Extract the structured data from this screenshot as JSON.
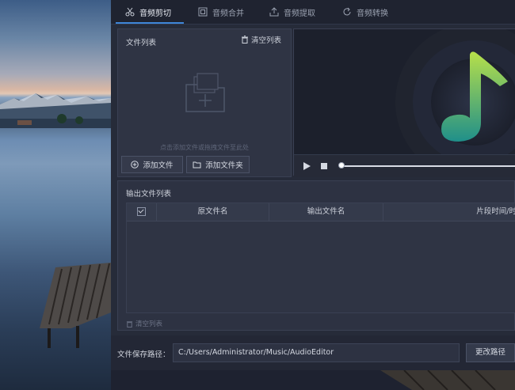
{
  "tabs": [
    {
      "label": "音频剪切",
      "icon": "scissors-icon",
      "active": true
    },
    {
      "label": "音频合并",
      "icon": "merge-icon",
      "active": false
    },
    {
      "label": "音频提取",
      "icon": "upload-icon",
      "active": false
    },
    {
      "label": "音频转换",
      "icon": "refresh-icon",
      "active": false
    }
  ],
  "file_list": {
    "title": "文件列表",
    "clear_label": "清空列表",
    "drop_hint": "点击添加文件或拖拽文件至此处",
    "add_file_label": "添加文件",
    "add_folder_label": "添加文件夹"
  },
  "player": {
    "progress": 0.0,
    "colors": {
      "note_top": "#b7e04a",
      "note_bottom": "#1f8f8a"
    }
  },
  "output": {
    "title": "输出文件列表",
    "columns": [
      "",
      "原文件名",
      "输出文件名",
      "片段时间/时"
    ],
    "clear_label": "清空列表"
  },
  "save": {
    "label": "文件保存路径：",
    "path": "C:/Users/Administrator/Music/AudioEditor",
    "change_label": "更改路径"
  },
  "colors": {
    "accent": "#3f86d8"
  }
}
